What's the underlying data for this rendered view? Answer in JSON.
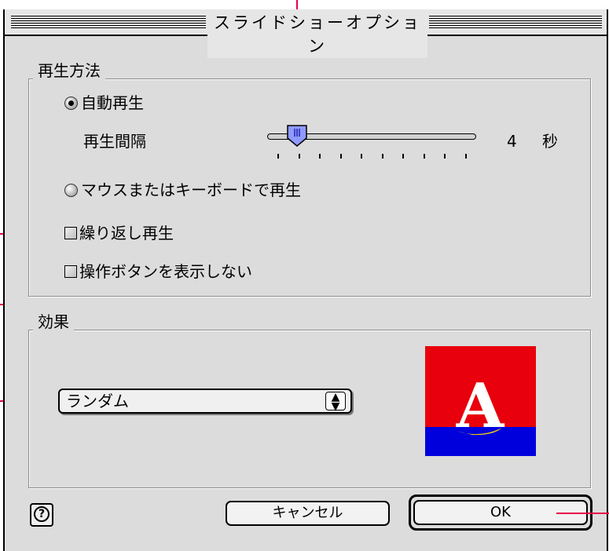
{
  "window": {
    "title": "スライドショーオプション"
  },
  "playback": {
    "group_label": "再生方法",
    "auto_label": "自動再生",
    "interval_label": "再生間隔",
    "interval_value": "4",
    "interval_unit": "秒",
    "interval_level": 0.1,
    "manual_label": "マウスまたはキーボードで再生",
    "selected": "auto",
    "repeat_label": "繰り返し再生",
    "repeat_checked": false,
    "hide_buttons_label": "操作ボタンを表示しない",
    "hide_buttons_checked": false
  },
  "effect": {
    "group_label": "効果",
    "selected": "ランダム",
    "preview_letter": "A",
    "colors": {
      "top": "#e8000c",
      "bottom": "#0000dd",
      "letter": "#ffffff",
      "glow": "#f5d400"
    }
  },
  "buttons": {
    "help": "?",
    "cancel": "キャンセル",
    "ok": "OK"
  },
  "callout_color": "#e8004a"
}
